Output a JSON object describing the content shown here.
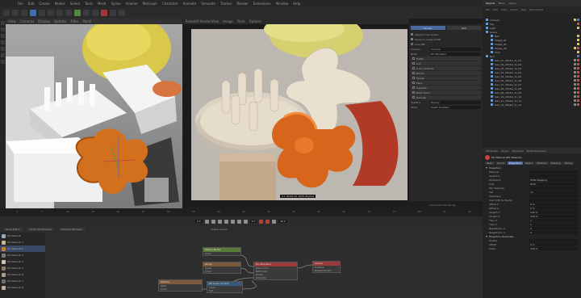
{
  "menubar": {
    "items": [
      "File",
      "Edit",
      "Create",
      "Modes",
      "Select",
      "Tools",
      "Mesh",
      "Spline",
      "Volume",
      "MoGraph",
      "Character",
      "Animate",
      "Simulate",
      "Tracker",
      "Render",
      "Extensions",
      "Window",
      "Help"
    ],
    "window_title": "Redshift"
  },
  "viewport_left": {
    "menu": [
      "View",
      "Cameras",
      "Display",
      "Options",
      "Filter",
      "Panel"
    ]
  },
  "viewport_right": {
    "menu": [
      "Redshift RenderView",
      "Image",
      "Tools",
      "Options"
    ],
    "status_text": "0.1  00:00:15  100%  Bucket",
    "progress_text": "Interactive Rendering"
  },
  "render_settings": {
    "buttons": [
      "Render",
      "AOV"
    ],
    "checkbox_rows": [
      {
        "label": "Apply to the render",
        "checked": true
      },
      {
        "label": "Apply to viewport IPR",
        "checked": true
      },
      {
        "label": "Lock IPR",
        "checked": false
      }
    ],
    "fields": [
      {
        "label": "Camera",
        "value": "Camera"
      },
      {
        "label": "Node",
        "value": "RS Standard"
      }
    ],
    "sections": [
      "Postfx",
      "LUT",
      "Color Controls",
      "Bloom",
      "Streak",
      "Flare",
      "Vignette",
      "Black Point",
      "Denoise"
    ],
    "extra_fields": [
      {
        "label": "Shading",
        "value": "Beauty"
      },
      {
        "label": "Mode",
        "value": "Postfx Enabled"
      }
    ]
  },
  "object_manager": {
    "tabs": [
      "Objects",
      "Takes",
      "Layers"
    ],
    "menu": [
      "File",
      "Edit",
      "View",
      "Object",
      "Tags",
      "Bookmarks"
    ],
    "objects": [
      {
        "name": "Camera",
        "depth": 0,
        "selected": false,
        "tags": [
          "#e6c84a",
          "#3d7de0"
        ]
      },
      {
        "name": "Sky",
        "depth": 0,
        "selected": false,
        "tags": [
          "#d84a4a"
        ]
      },
      {
        "name": "Light",
        "depth": 0,
        "selected": false,
        "tags": [
          "#e6c84a"
        ]
      },
      {
        "name": "Scene",
        "depth": 0,
        "selected": false,
        "tags": []
      },
      {
        "name": "Ball",
        "depth": 1,
        "selected": false,
        "tags": [
          "#e6c84a"
        ]
      },
      {
        "name": "Shape_01",
        "depth": 1,
        "selected": false,
        "tags": [
          "#e6c84a"
        ]
      },
      {
        "name": "Shape_02",
        "depth": 1,
        "selected": false,
        "tags": [
          "#e6c84a"
        ]
      },
      {
        "name": "Shape_03",
        "depth": 1,
        "selected": false,
        "tags": [
          "#e6c84a",
          "#d84a4a"
        ]
      },
      {
        "name": "Floor",
        "depth": 1,
        "selected": false,
        "tags": [
          "#e6c84a"
        ]
      },
      {
        "name": "Null",
        "depth": 0,
        "selected": false,
        "tags": [
          "#3d7de0"
        ]
      },
      {
        "name": "Geo_01_xfinder_tx_01",
        "depth": 1,
        "selected": false,
        "tags": [
          "#888",
          "#d84a4a"
        ]
      },
      {
        "name": "Geo_02_xfinder_tx_02",
        "depth": 1,
        "selected": false,
        "tags": [
          "#888",
          "#d84a4a"
        ]
      },
      {
        "name": "Geo_03_xfinder_tx_03",
        "depth": 1,
        "selected": false,
        "tags": [
          "#888",
          "#d84a4a"
        ]
      },
      {
        "name": "Geo_04_xfinder_tx_04",
        "depth": 1,
        "selected": false,
        "tags": [
          "#888",
          "#d84a4a"
        ]
      },
      {
        "name": "Geo_05_xfinder_tx_05",
        "depth": 1,
        "selected": false,
        "tags": [
          "#888",
          "#d84a4a"
        ]
      },
      {
        "name": "Geo_06_xfinder_tx_06",
        "depth": 1,
        "selected": false,
        "tags": [
          "#888",
          "#d84a4a"
        ]
      },
      {
        "name": "Geo_07_xfinder_tx_07",
        "depth": 1,
        "selected": false,
        "tags": [
          "#888",
          "#d84a4a"
        ]
      },
      {
        "name": "Geo_08_xfinder_tx_08",
        "depth": 1,
        "selected": false,
        "tags": [
          "#888",
          "#d84a4a"
        ]
      },
      {
        "name": "Geo_09_xfinder_tx_09",
        "depth": 1,
        "selected": false,
        "tags": [
          "#888",
          "#d84a4a"
        ]
      },
      {
        "name": "Geo_10_xfinder_tx_10",
        "depth": 1,
        "selected": false,
        "tags": [
          "#888",
          "#d84a4a"
        ]
      },
      {
        "name": "Geo_11_xfinder_tx_11",
        "depth": 1,
        "selected": false,
        "tags": [
          "#888",
          "#d84a4a"
        ]
      },
      {
        "name": "Geo_12_xfinder_tx_12",
        "depth": 1,
        "selected": false,
        "tags": [
          "#888",
          "#d84a4a"
        ]
      }
    ]
  },
  "attributes": {
    "tabs": [
      "Attributes",
      "Layers",
      "Structure",
      "Node Properties"
    ],
    "object_name": "RS Material [RS Material]",
    "subtabs": [
      "Basic",
      "Coord.",
      "Projection",
      "Object",
      "Material",
      "Shading",
      "Phong"
    ],
    "active_subtab": "Projection",
    "section_title": "Projection",
    "rows": [
      {
        "label": "Material",
        "value": ""
      },
      {
        "label": "Selection",
        "value": ""
      },
      {
        "label": "Projection",
        "value": "UVW Mapping"
      },
      {
        "label": "Side",
        "value": "Both"
      },
      {
        "label": "Mix Textures",
        "value": ""
      },
      {
        "label": "Tile",
        "value": "on"
      },
      {
        "label": "Seamless",
        "value": ""
      },
      {
        "label": "Use UVW for Bump",
        "value": ""
      },
      {
        "label": "Offset U",
        "value": "0 %"
      },
      {
        "label": "Offset V",
        "value": "0 %"
      },
      {
        "label": "Length U",
        "value": "100 %"
      },
      {
        "label": "Length V",
        "value": "100 %"
      },
      {
        "label": "Tiles U",
        "value": "1"
      },
      {
        "label": "Tiles V",
        "value": "1"
      },
      {
        "label": "Repetitions U",
        "value": "0"
      },
      {
        "label": "Repetitions V",
        "value": "0"
      }
    ],
    "section2": "Projection Overrides",
    "rows2": [
      {
        "label": "Enable",
        "value": ""
      },
      {
        "label": "Offset",
        "value": "0 %"
      },
      {
        "label": "Scale",
        "value": "100 %"
      }
    ]
  },
  "timeline": {
    "ticks": [
      "0",
      "5",
      "10",
      "15",
      "20",
      "25",
      "30",
      "35",
      "40",
      "45",
      "50",
      "55",
      "60",
      "65",
      "70",
      "75",
      "80",
      "85",
      "90"
    ],
    "start_frame": "0 F",
    "end_frame": "90 F",
    "current_frame": "0 F"
  },
  "node_editor": {
    "tabs": [
      "Node Editor",
      "Node: RS Material",
      "Material Manager"
    ],
    "breadcrumb": "Shader Graph",
    "materials": [
      {
        "name": "RS Material",
        "color": "#9aa8b8",
        "selected": false
      },
      {
        "name": "RS Material.1",
        "color": "#c8b89a",
        "selected": false
      },
      {
        "name": "RS Material.2",
        "color": "#c87838",
        "selected": true
      },
      {
        "name": "RS Material.3",
        "color": "#7a7a7a",
        "selected": false
      },
      {
        "name": "RS Material.4",
        "color": "#d0c4b4",
        "selected": false
      },
      {
        "name": "RS Material.5",
        "color": "#8c7a68",
        "selected": false
      },
      {
        "name": "RS Material.6",
        "color": "#a89c8c",
        "selected": false
      },
      {
        "name": "RS Material.7",
        "color": "#6e6e6e",
        "selected": false
      },
      {
        "name": "RS Material.8",
        "color": "#c0b0a0",
        "selected": false
      }
    ],
    "nodes": [
      {
        "title": "Maxon Noise",
        "color": "#5a7a3a",
        "ports": [
          "Color"
        ]
      },
      {
        "title": "Ramp",
        "color": "#7a5a3a",
        "ports": [
          "Input",
          "Color"
        ]
      },
      {
        "title": "Texture",
        "color": "#7a5a3a",
        "ports": [
          "Tex0",
          "Color"
        ]
      },
      {
        "title": "RS Color Correct",
        "color": "#3a5a7a",
        "ports": [
          "Input",
          "Out"
        ]
      },
      {
        "title": "RS Standard",
        "color": "#9a3a3a",
        "ports": [
          "Base Color",
          "Refl Color",
          "Bump",
          "Outcolor"
        ]
      },
      {
        "title": "Output",
        "color": "#9a3a3a",
        "ports": [
          "Surface",
          "Displacement"
        ]
      }
    ]
  }
}
